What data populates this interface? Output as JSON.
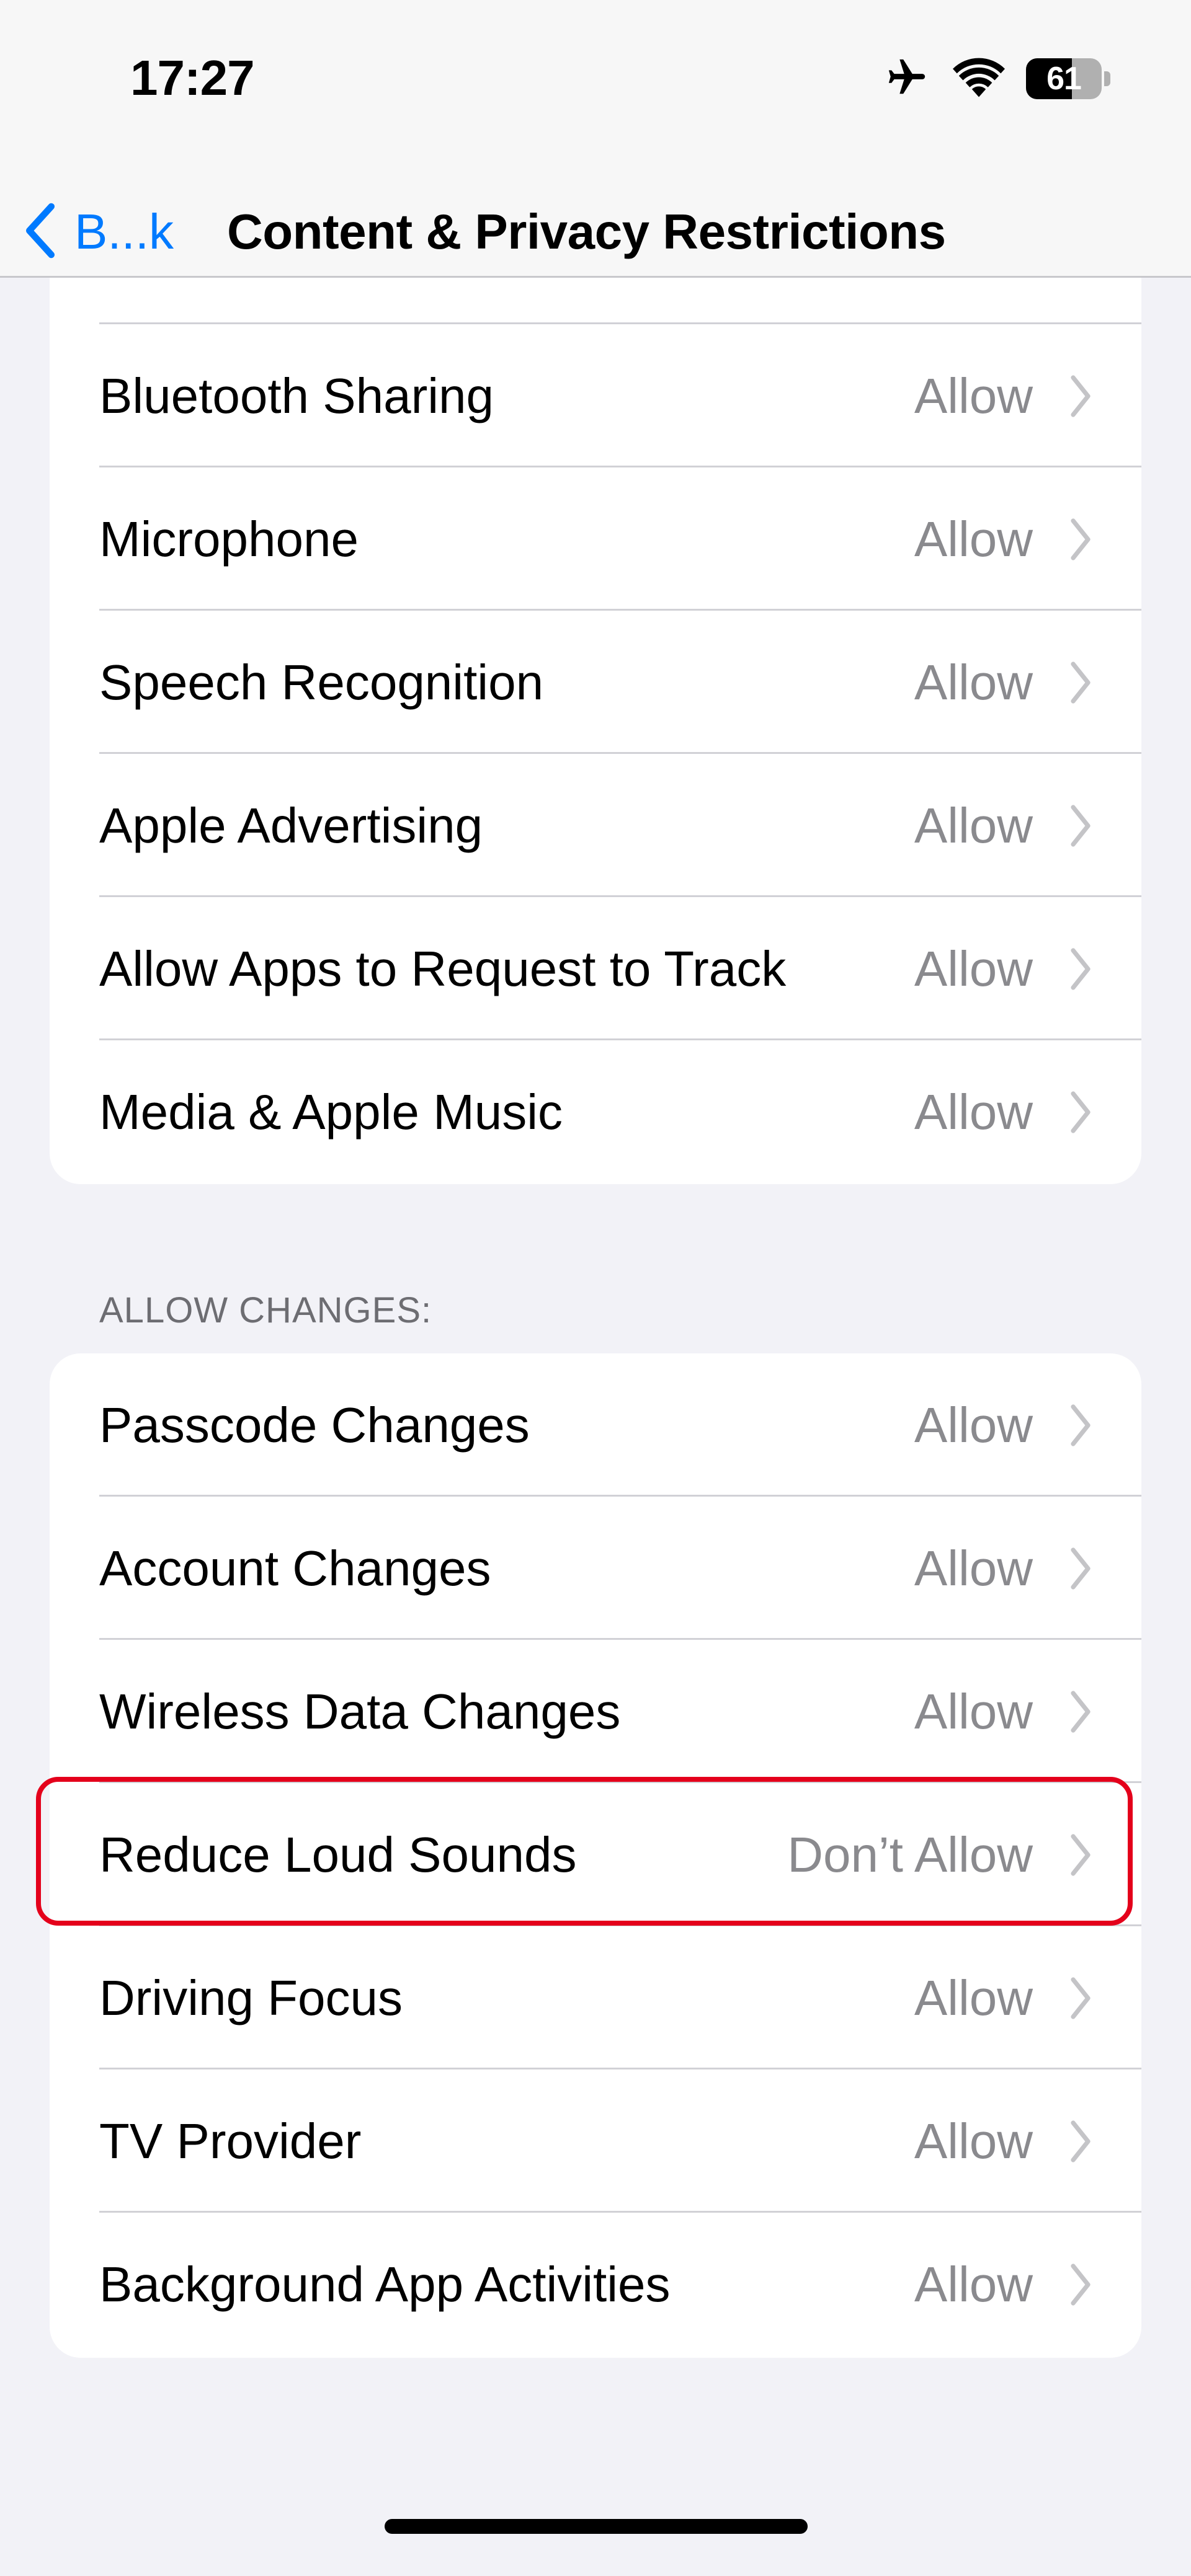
{
  "status_bar": {
    "time": "17:27",
    "icons": [
      "airplane-icon",
      "wifi-icon",
      "battery-icon"
    ],
    "battery_percent": 61,
    "battery_label": "61"
  },
  "nav": {
    "back_label": "B...k",
    "title": "Content & Privacy Restrictions",
    "accent_color": "#007aff"
  },
  "sections": [
    {
      "header": "",
      "rows": [
        {
          "label": "Bluetooth Sharing",
          "value": "Allow"
        },
        {
          "label": "Microphone",
          "value": "Allow"
        },
        {
          "label": "Speech Recognition",
          "value": "Allow"
        },
        {
          "label": "Apple Advertising",
          "value": "Allow"
        },
        {
          "label": "Allow Apps to Request to Track",
          "value": "Allow"
        },
        {
          "label": "Media & Apple Music",
          "value": "Allow"
        }
      ]
    },
    {
      "header": "ALLOW CHANGES:",
      "rows": [
        {
          "label": "Passcode Changes",
          "value": "Allow"
        },
        {
          "label": "Account Changes",
          "value": "Allow"
        },
        {
          "label": "Wireless Data Changes",
          "value": "Allow"
        },
        {
          "label": "Reduce Loud Sounds",
          "value": "Don’t Allow",
          "highlighted": true
        },
        {
          "label": "Driving Focus",
          "value": "Allow"
        },
        {
          "label": "TV Provider",
          "value": "Allow"
        },
        {
          "label": "Background App Activities",
          "value": "Allow"
        }
      ]
    }
  ],
  "highlight_color": "#e4001b"
}
